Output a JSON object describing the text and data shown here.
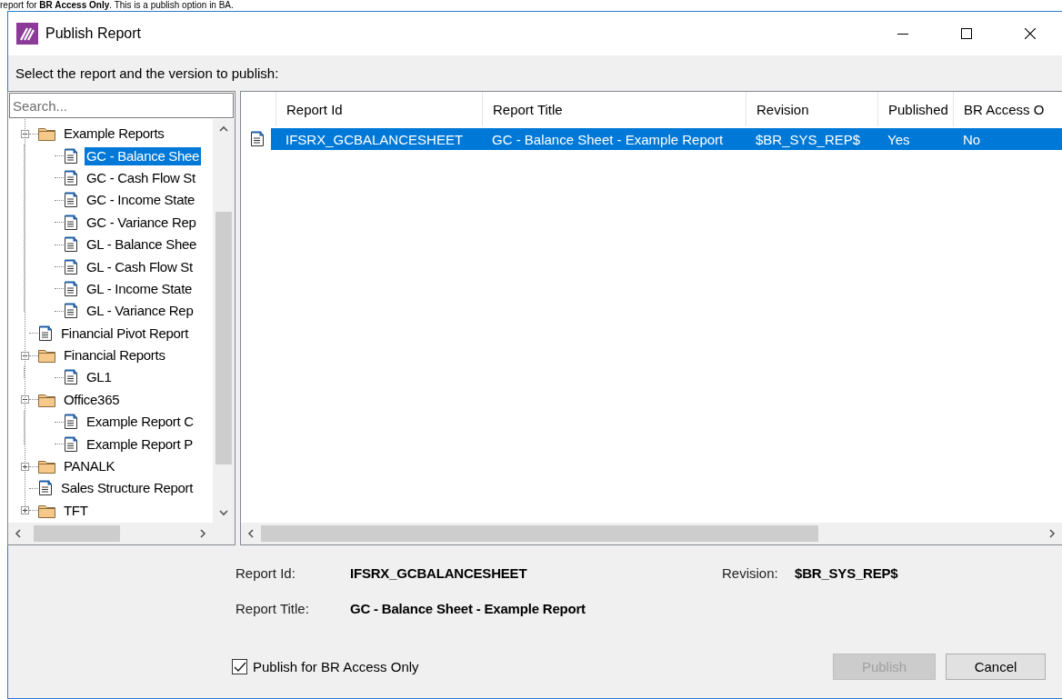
{
  "caption": "report for **BR Access Only**. This is a publish option in BA.",
  "window": {
    "title": "Publish Report"
  },
  "instruction": "Select the report and the version to publish:",
  "tree": {
    "search": {
      "placeholder": "Search..."
    },
    "items": [
      {
        "label": "Example Reports",
        "kind": "folder",
        "expanded": true,
        "selected": false,
        "children": [
          {
            "label": "GC - Balance Shee",
            "kind": "report",
            "selected": true
          },
          {
            "label": "GC - Cash Flow St",
            "kind": "report",
            "selected": false
          },
          {
            "label": "GC - Income State",
            "kind": "report",
            "selected": false
          },
          {
            "label": "GC - Variance Rep",
            "kind": "report",
            "selected": false
          },
          {
            "label": "GL - Balance Shee",
            "kind": "report",
            "selected": false
          },
          {
            "label": "GL - Cash Flow St",
            "kind": "report",
            "selected": false
          },
          {
            "label": "GL - Income State",
            "kind": "report",
            "selected": false
          },
          {
            "label": "GL - Variance Rep",
            "kind": "report",
            "selected": false
          }
        ]
      },
      {
        "label": "Financial Pivot Report",
        "kind": "report",
        "selected": false
      },
      {
        "label": "Financial Reports",
        "kind": "folder",
        "expanded": true,
        "selected": false,
        "children": [
          {
            "label": "GL1",
            "kind": "report",
            "selected": false
          }
        ]
      },
      {
        "label": "Office365",
        "kind": "folder",
        "expanded": true,
        "selected": false,
        "children": [
          {
            "label": "Example Report C",
            "kind": "report",
            "selected": false
          },
          {
            "label": "Example Report P",
            "kind": "report",
            "selected": false
          }
        ]
      },
      {
        "label": "PANALK",
        "kind": "folder",
        "expanded": false,
        "selected": false
      },
      {
        "label": "Sales Structure Report",
        "kind": "report",
        "selected": false
      },
      {
        "label": "TFT",
        "kind": "folder",
        "expanded": false,
        "selected": false
      }
    ]
  },
  "table": {
    "columns": [
      "Report Id",
      "Report Title",
      "Revision",
      "Published",
      "BR Access O"
    ],
    "rows": [
      {
        "selected": true,
        "cells": [
          "IFSRX_GCBALANCESHEET",
          "GC - Balance Sheet - Example Report",
          "$BR_SYS_REP$",
          "Yes",
          "No"
        ]
      }
    ]
  },
  "details": [
    {
      "label": "Report Id:",
      "value": "IFSRX_GCBALANCESHEET"
    },
    {
      "label": "Revision:",
      "value": "$BR_SYS_REP$"
    },
    {
      "label": "Report Title:",
      "value": "GC - Balance Sheet - Example Report"
    }
  ],
  "checkbox": {
    "label": "Publish for BR Access Only",
    "checked": true
  },
  "buttons": [
    {
      "label": "Publish",
      "disabled": true
    },
    {
      "label": "Cancel",
      "disabled": false
    }
  ]
}
